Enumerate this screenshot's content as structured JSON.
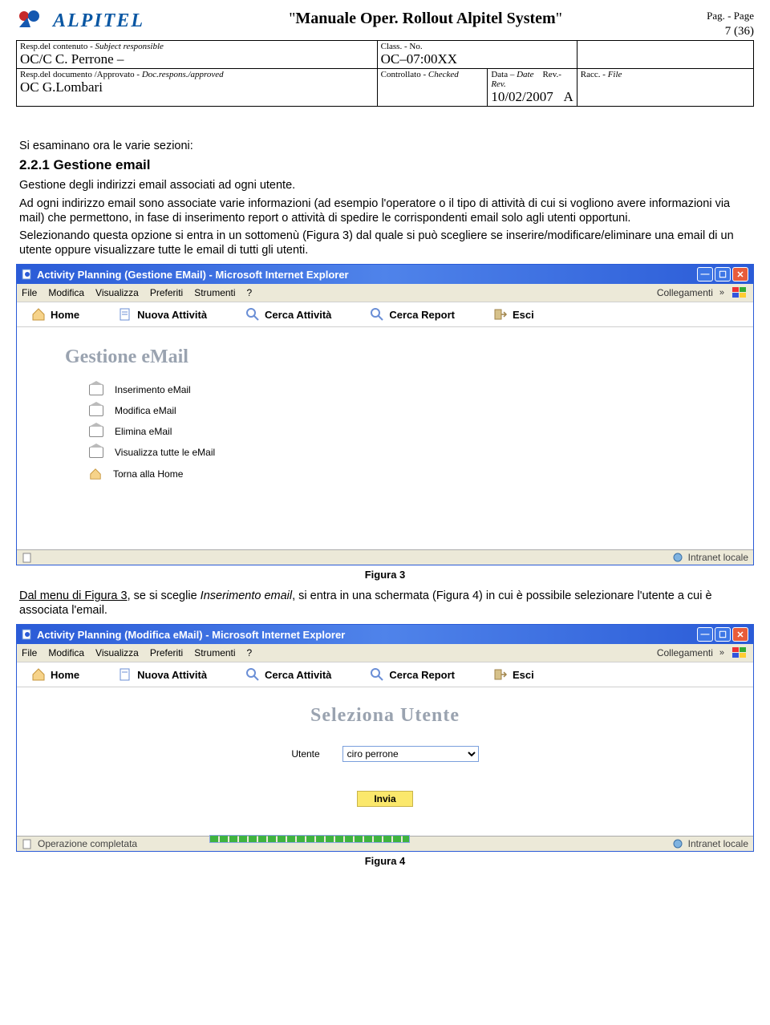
{
  "header": {
    "logo_text": "ALPITEL",
    "doc_title": "Manuale Oper. Rollout Alpitel System",
    "page_label": "Pag. - Page",
    "page_no": "7 (36)",
    "row1": {
      "c1_lab": "Resp.del contenuto - Subject responsible",
      "c1_val": "OC/C C. Perrone –",
      "c2_lab": "Class. - No.",
      "c2_val": "OC–07:00XX"
    },
    "row2": {
      "c1_lab": "Resp.del documento /Approvato - Doc.respons./approved",
      "c1_val": "OC G.Lombari",
      "c2_lab": "Controllato - Checked",
      "c3_lab": "Data – Date",
      "c3_val": "10/02/2007",
      "c4_lab": "Rev.- Rev.",
      "c4_val": "A",
      "c5_lab": "Racc. - File"
    }
  },
  "body": {
    "intro": "Si esaminano ora le varie sezioni:",
    "h2": "2.2.1 Gestione email",
    "p1": "Gestione degli indirizzi email associati ad ogni utente.",
    "p2": "Ad ogni indirizzo email sono associate varie informazioni (ad esempio l'operatore o il tipo di attività di cui si vogliono avere informazioni via mail) che permettono, in fase di inserimento report o attività di spedire le corrispondenti email solo agli utenti opportuni.",
    "p3": "Selezionando questa opzione si entra in un sottomenù (Figura 3) dal quale si può scegliere se inserire/modificare/eliminare una email di un utente oppure visualizzare tutte le email di tutti gli utenti.",
    "fig3": "Figura 3",
    "p4a": "Dal menu di Figura 3",
    "p4b": ", se si sceglie ",
    "p4c": "Inserimento email",
    "p4d": ", si entra in una schermata (Figura 4) in cui è possibile selezionare l'utente a cui è associata l'email.",
    "fig4": "Figura 4"
  },
  "win1": {
    "title": "Activity Planning (Gestione EMail) - Microsoft Internet Explorer",
    "menu": [
      "File",
      "Modifica",
      "Visualizza",
      "Preferiti",
      "Strumenti",
      "?"
    ],
    "collegamenti": "Collegamenti",
    "toolbar": [
      "Home",
      "Nuova Attività",
      "Cerca Attività",
      "Cerca Report",
      "Esci"
    ],
    "section_title": "Gestione eMail",
    "items": [
      "Inserimento eMail",
      "Modifica eMail",
      "Elimina eMail",
      "Visualizza tutte le eMail",
      "Torna alla Home"
    ],
    "status_left": "",
    "status_right": "Intranet locale"
  },
  "win2": {
    "title": "Activity Planning (Modifica eMail) - Microsoft Internet Explorer",
    "menu": [
      "File",
      "Modifica",
      "Visualizza",
      "Preferiti",
      "Strumenti",
      "?"
    ],
    "collegamenti": "Collegamenti",
    "toolbar": [
      "Home",
      "Nuova Attività",
      "Cerca Attività",
      "Cerca Report",
      "Esci"
    ],
    "section_title": "Seleziona Utente",
    "form_label": "Utente",
    "select_value": "ciro perrone",
    "submit": "Invia",
    "status_left": "Operazione completata",
    "status_right": "Intranet locale"
  }
}
